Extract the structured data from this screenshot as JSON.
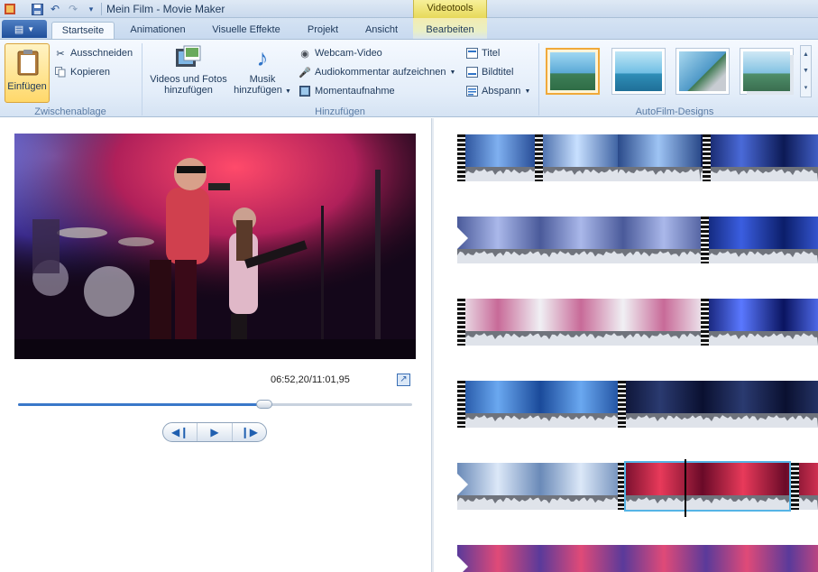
{
  "window": {
    "title": "Mein Film - Movie Maker",
    "context_group": "Videotools"
  },
  "qat": {
    "icons": [
      "movie-maker-app-icon",
      "save-icon",
      "undo-icon",
      "redo-icon",
      "customize-dropdown-icon"
    ]
  },
  "tabs": [
    {
      "label": "Startseite",
      "active": true
    },
    {
      "label": "Animationen",
      "active": false
    },
    {
      "label": "Visuelle Effekte",
      "active": false
    },
    {
      "label": "Projekt",
      "active": false
    },
    {
      "label": "Ansicht",
      "active": false
    },
    {
      "label": "Bearbeiten",
      "active": false,
      "contextual": true
    }
  ],
  "ribbon": {
    "clipboard": {
      "paste": "Einfügen",
      "cut": "Ausschneiden",
      "copy": "Kopieren",
      "group_label": "Zwischenablage"
    },
    "add": {
      "videos_photos": "Videos und Fotos hinzufügen",
      "music": "Musik hinzufügen",
      "webcam": "Webcam-Video",
      "narration": "Audiokommentar aufzeichnen",
      "snapshot": "Momentaufnahme",
      "title": "Titel",
      "caption": "Bildtitel",
      "credits": "Abspann",
      "group_label": "Hinzufügen"
    },
    "themes": {
      "group_label": "AutoFilm-Designs",
      "selected_index": 0,
      "count": 4
    }
  },
  "preview": {
    "time": "06:52,20/11:01,95",
    "progress": 0.624
  },
  "colors": {
    "accent": "#3a78c9",
    "selection": "#55b4e6",
    "context_tab": "#e7d95a"
  }
}
